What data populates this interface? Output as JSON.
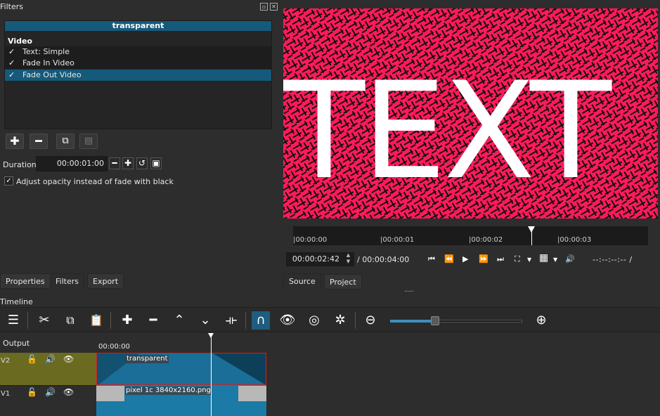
{
  "filters_panel": {
    "title": "Filters",
    "clip_name": "transparent",
    "category": "Video",
    "filters": [
      {
        "label": "Text: Simple",
        "checked": true,
        "selected": false
      },
      {
        "label": "Fade In Video",
        "checked": true,
        "selected": false
      },
      {
        "label": "Fade Out Video",
        "checked": true,
        "selected": true
      }
    ],
    "toolbar_icons": [
      "add-icon",
      "remove-icon",
      "copy-icon",
      "paste-icon"
    ],
    "duration_label": "Duration",
    "duration_value": "00:00:01:00",
    "opacity_checkbox_label": "Adjust opacity instead of fade with black",
    "opacity_checked": true
  },
  "left_tabs": [
    "Properties",
    "Filters",
    "Export"
  ],
  "active_left_tab": "Filters",
  "player": {
    "preview_text": "TEXT",
    "ruler_labels": [
      "|00:00:00",
      "|00:00:01",
      "|00:00:02",
      "|00:00:03"
    ],
    "current_time": "00:00:02:42",
    "total_duration": "/ 00:00:04:00",
    "in_out": "--:--:--:-- /",
    "tabs": [
      "Source",
      "Project"
    ],
    "active_tab": "Source",
    "colors": {
      "preview_bg": "#ff1a5a"
    }
  },
  "timeline": {
    "title": "Timeline",
    "output_label": "Output",
    "ruler_time": "00:00:00",
    "tracks": [
      {
        "name": "V2",
        "clip": "transparent"
      },
      {
        "name": "V1",
        "clip": "pixel 1c 3840x2160.png"
      }
    ],
    "zoom_level": 0.34,
    "colors": {
      "accent": "#1f5c80",
      "v2_header": "#6b6a21",
      "clip": "#1b6f98"
    }
  }
}
